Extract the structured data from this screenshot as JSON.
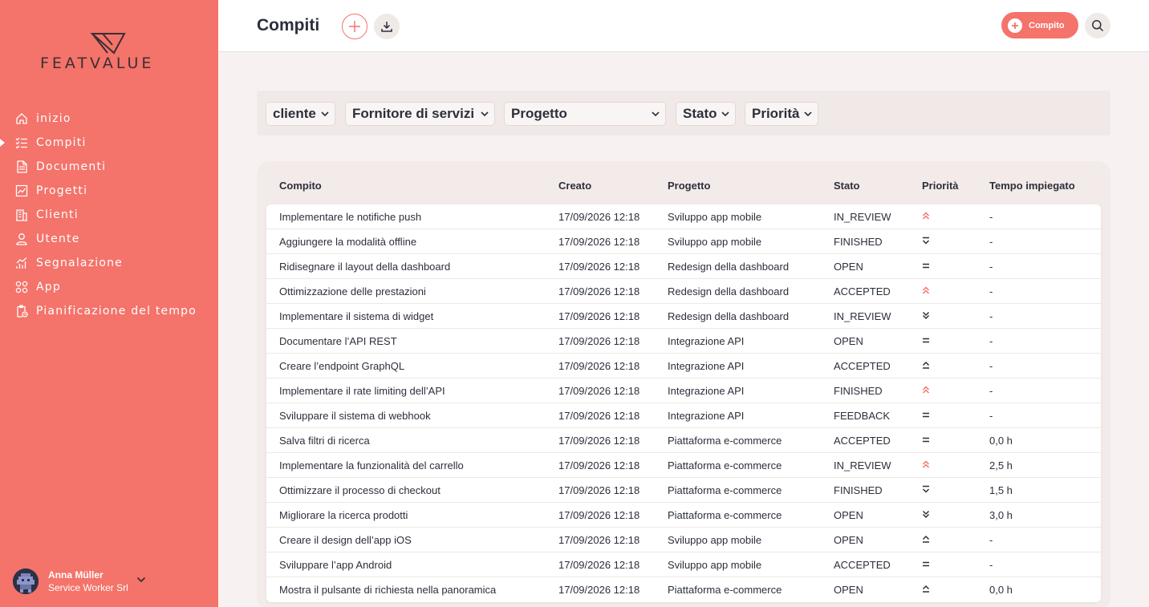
{
  "sidebar": {
    "logo_text": "FEATVALUE",
    "items": [
      {
        "label": "inizio",
        "icon": "home-icon",
        "active": false
      },
      {
        "label": "Compiti",
        "icon": "task-list-icon",
        "active": true
      },
      {
        "label": "Documenti",
        "icon": "document-icon",
        "active": false
      },
      {
        "label": "Progetti",
        "icon": "chart-icon",
        "active": false
      },
      {
        "label": "Clienti",
        "icon": "building-icon",
        "active": false
      },
      {
        "label": "Utente",
        "icon": "user-icon",
        "active": false
      },
      {
        "label": "Segnalazione",
        "icon": "report-icon",
        "active": false
      },
      {
        "label": "App",
        "icon": "apps-icon",
        "active": false
      },
      {
        "label": "Pianificazione del tempo",
        "icon": "clipboard-clock-icon",
        "active": false
      }
    ],
    "user": {
      "name": "Anna Müller",
      "company": "Service Worker Srl"
    }
  },
  "header": {
    "title": "Compiti",
    "new_task_label": "Compito"
  },
  "filters": [
    {
      "label": "cliente"
    },
    {
      "label": "Fornitore di servizi"
    },
    {
      "label": "Progetto"
    },
    {
      "label": "Stato"
    },
    {
      "label": "Priorità"
    }
  ],
  "table": {
    "columns": [
      "Compito",
      "Creato",
      "Progetto",
      "Stato",
      "Priorità",
      "Tempo impiegato"
    ],
    "rows": [
      {
        "task": "Implementare le notifiche push",
        "created": "17/09/2026 12:18",
        "project": "Sviluppo app mobile",
        "status": "IN_REVIEW",
        "priority": "highest",
        "time": "-"
      },
      {
        "task": "Aggiungere la modalità offline",
        "created": "17/09/2026 12:18",
        "project": "Sviluppo app mobile",
        "status": "FINISHED",
        "priority": "low",
        "time": "-"
      },
      {
        "task": "Ridisegnare il layout della dashboard",
        "created": "17/09/2026 12:18",
        "project": "Redesign della dashboard",
        "status": "OPEN",
        "priority": "medium",
        "time": "-"
      },
      {
        "task": "Ottimizzazione delle prestazioni",
        "created": "17/09/2026 12:18",
        "project": "Redesign della dashboard",
        "status": "ACCEPTED",
        "priority": "highest",
        "time": "-"
      },
      {
        "task": "Implementare il sistema di widget",
        "created": "17/09/2026 12:18",
        "project": "Redesign della dashboard",
        "status": "IN_REVIEW",
        "priority": "lowest",
        "time": "-"
      },
      {
        "task": "Documentare l’API REST",
        "created": "17/09/2026 12:18",
        "project": "Integrazione API",
        "status": "OPEN",
        "priority": "medium",
        "time": "-"
      },
      {
        "task": "Creare l’endpoint GraphQL",
        "created": "17/09/2026 12:18",
        "project": "Integrazione API",
        "status": "ACCEPTED",
        "priority": "high",
        "time": "-"
      },
      {
        "task": "Implementare il rate limiting dell’API",
        "created": "17/09/2026 12:18",
        "project": "Integrazione API",
        "status": "FINISHED",
        "priority": "highest",
        "time": "-"
      },
      {
        "task": "Sviluppare il sistema di webhook",
        "created": "17/09/2026 12:18",
        "project": "Integrazione API",
        "status": "FEEDBACK",
        "priority": "medium",
        "time": "-"
      },
      {
        "task": "Salva filtri di ricerca",
        "created": "17/09/2026 12:18",
        "project": "Piattaforma e-commerce",
        "status": "ACCEPTED",
        "priority": "medium",
        "time": "0,0 h"
      },
      {
        "task": "Implementare la funzionalità del carrello",
        "created": "17/09/2026 12:18",
        "project": "Piattaforma e-commerce",
        "status": "IN_REVIEW",
        "priority": "highest",
        "time": "2,5 h"
      },
      {
        "task": "Ottimizzare il processo di checkout",
        "created": "17/09/2026 12:18",
        "project": "Piattaforma e-commerce",
        "status": "FINISHED",
        "priority": "low",
        "time": "1,5 h"
      },
      {
        "task": "Migliorare la ricerca prodotti",
        "created": "17/09/2026 12:18",
        "project": "Piattaforma e-commerce",
        "status": "OPEN",
        "priority": "lowest",
        "time": "3,0 h"
      },
      {
        "task": "Creare il design dell’app iOS",
        "created": "17/09/2026 12:18",
        "project": "Sviluppo app mobile",
        "status": "OPEN",
        "priority": "high",
        "time": "-"
      },
      {
        "task": "Sviluppare l’app Android",
        "created": "17/09/2026 12:18",
        "project": "Sviluppo app mobile",
        "status": "ACCEPTED",
        "priority": "medium",
        "time": "-"
      },
      {
        "task": "Mostra il pulsante di richiesta nella panoramica",
        "created": "17/09/2026 12:18",
        "project": "Piattaforma e-commerce",
        "status": "OPEN",
        "priority": "high",
        "time": "0,0 h"
      }
    ]
  },
  "colors": {
    "accent": "#f4736a",
    "text": "#2c2f3a"
  }
}
